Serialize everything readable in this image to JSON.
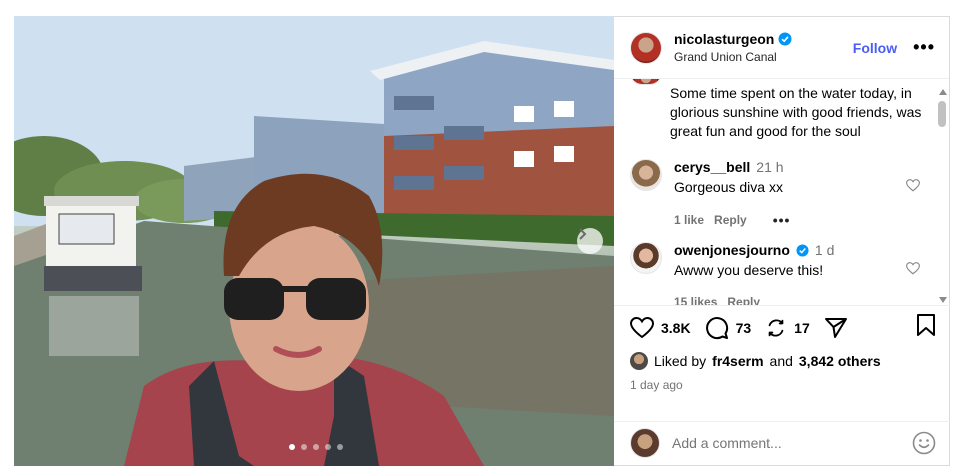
{
  "post": {
    "username": "nicolasturgeon",
    "location": "Grand Union Canal",
    "follow_label": "Follow",
    "more_label": "•••",
    "caption": "Some time spent on the water today, in glorious sunshine with good friends, was great fun and good for the soul"
  },
  "comments": [
    {
      "username": "cerys__bell",
      "time": "21 h",
      "text": "Gorgeous diva xx",
      "likes": "1 like",
      "reply_label": "Reply",
      "verified": false
    },
    {
      "username": "owenjonesjourno",
      "time": "1 d",
      "text": "Awww you deserve this!",
      "likes": "15 likes",
      "reply_label": "Reply",
      "verified": true
    }
  ],
  "actions": {
    "likes_count": "3.8K",
    "comments_count": "73",
    "reposts_count": "17"
  },
  "liked_by": {
    "prefix": "Liked by",
    "user": "fr4serm",
    "middle": "and",
    "others": "3,842 others"
  },
  "date": "1 day ago",
  "add_comment": {
    "placeholder": "Add a comment..."
  },
  "carousel": {
    "total": 5,
    "current": 1
  },
  "colors": {
    "accent": "#4a5df9",
    "verified": "#0095f6",
    "muted": "#737373"
  },
  "icons": [
    "verified-badge-icon",
    "chevron-right-icon",
    "heart-icon",
    "comment-icon",
    "repost-icon",
    "share-icon",
    "bookmark-icon",
    "emoji-icon"
  ]
}
